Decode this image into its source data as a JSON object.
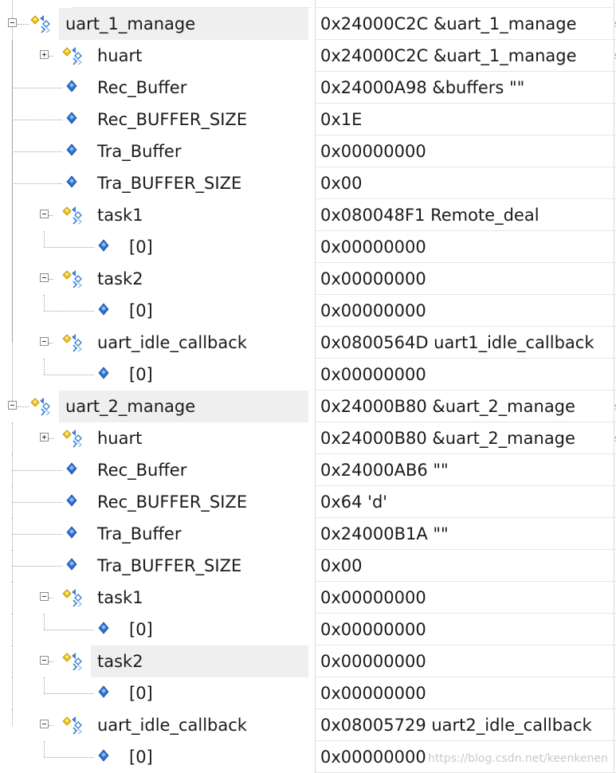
{
  "rows": [
    {
      "depth": 0,
      "kind": "struct",
      "toggle": "minus",
      "name": "uart_1_manage",
      "value": "0x24000C2C &uart_1_manage",
      "selected": true,
      "edge": true
    },
    {
      "depth": 1,
      "kind": "struct",
      "toggle": "plus",
      "name": "huart",
      "value": "0x24000C2C &uart_1_manage",
      "edge": true
    },
    {
      "depth": 1,
      "kind": "field",
      "name": "Rec_Buffer",
      "value": "0x24000A98 &buffers \"\""
    },
    {
      "depth": 1,
      "kind": "field",
      "name": "Rec_BUFFER_SIZE",
      "value": "0x1E"
    },
    {
      "depth": 1,
      "kind": "field",
      "name": "Tra_Buffer",
      "value": "0x00000000"
    },
    {
      "depth": 1,
      "kind": "field",
      "name": "Tra_BUFFER_SIZE",
      "value": "0x00"
    },
    {
      "depth": 1,
      "kind": "struct",
      "toggle": "minus",
      "name": "task1",
      "value": "0x080048F1 Remote_deal"
    },
    {
      "depth": 2,
      "kind": "field",
      "name": "[0]",
      "value": "0x00000000"
    },
    {
      "depth": 1,
      "kind": "struct",
      "toggle": "minus",
      "name": "task2",
      "value": "0x00000000"
    },
    {
      "depth": 2,
      "kind": "field",
      "name": "[0]",
      "value": "0x00000000"
    },
    {
      "depth": 1,
      "kind": "struct",
      "toggle": "minus",
      "name": "uart_idle_callback",
      "value": "0x0800564D uart1_idle_callback"
    },
    {
      "depth": 2,
      "kind": "field",
      "name": "[0]",
      "value": "0x00000000"
    },
    {
      "depth": 0,
      "kind": "struct",
      "toggle": "minus",
      "name": "uart_2_manage",
      "value": "0x24000B80 &uart_2_manage",
      "selected": true,
      "edge": true
    },
    {
      "depth": 1,
      "kind": "struct",
      "toggle": "plus",
      "name": "huart",
      "value": "0x24000B80 &uart_2_manage",
      "edge": true
    },
    {
      "depth": 1,
      "kind": "field",
      "name": "Rec_Buffer",
      "value": "0x24000AB6 \"\""
    },
    {
      "depth": 1,
      "kind": "field",
      "name": "Rec_BUFFER_SIZE",
      "value": "0x64 'd'"
    },
    {
      "depth": 1,
      "kind": "field",
      "name": "Tra_Buffer",
      "value": "0x24000B1A \"\""
    },
    {
      "depth": 1,
      "kind": "field",
      "name": "Tra_BUFFER_SIZE",
      "value": "0x00"
    },
    {
      "depth": 1,
      "kind": "struct",
      "toggle": "minus",
      "name": "task1",
      "value": "0x00000000"
    },
    {
      "depth": 2,
      "kind": "field",
      "name": "[0]",
      "value": "0x00000000"
    },
    {
      "depth": 1,
      "kind": "struct",
      "toggle": "minus",
      "name": "task2",
      "value": "0x00000000",
      "selected": true
    },
    {
      "depth": 2,
      "kind": "field",
      "name": "[0]",
      "value": "0x00000000"
    },
    {
      "depth": 1,
      "kind": "struct",
      "toggle": "minus",
      "name": "uart_idle_callback",
      "value": "0x08005729 uart2_idle_callback"
    },
    {
      "depth": 2,
      "kind": "field",
      "name": "[0]",
      "value": "0x00000000"
    }
  ],
  "edge_char": "s",
  "watermark": "https://blog.csdn.net/keenkenen",
  "colors": {
    "struct_icon_yellow": "#f2c21a",
    "struct_icon_blue": "#3c7fd6",
    "field_icon_blue": "#2a6fd3",
    "selected_bg": "#efefef",
    "grid": "#e6e6e6"
  },
  "icons": {
    "struct": "struct-member-icon",
    "field": "field-member-icon"
  }
}
